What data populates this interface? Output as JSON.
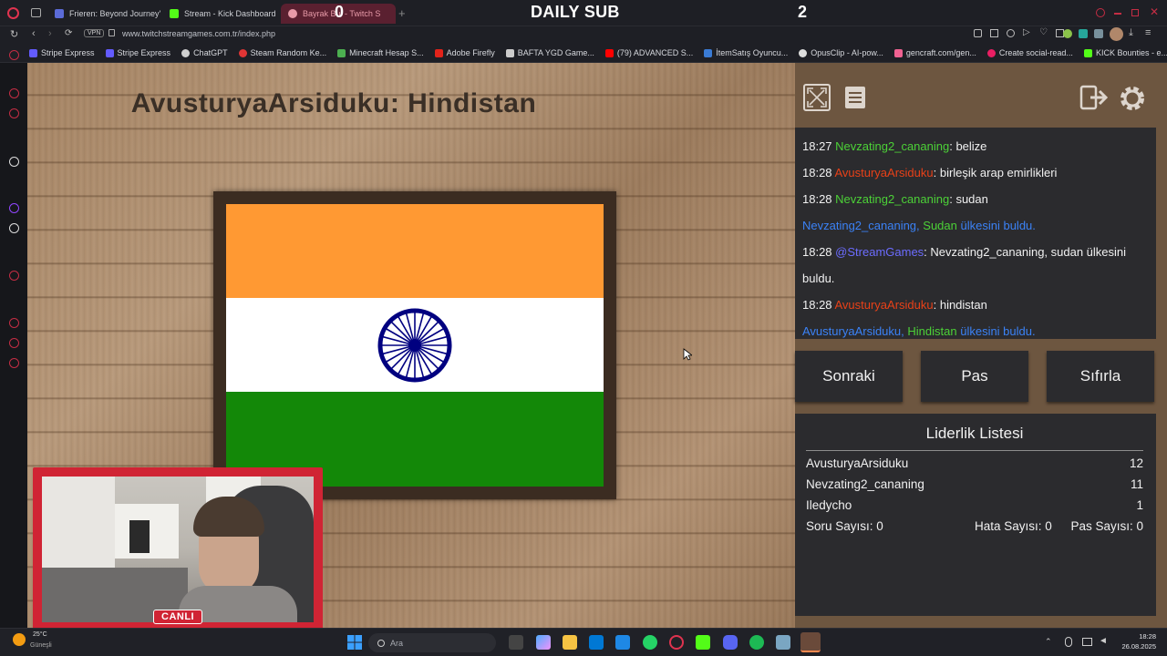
{
  "browser": {
    "tabs": [
      {
        "label": "Frieren: Beyond Journey's",
        "color": "#5b6bd8"
      },
      {
        "label": "Stream - Kick Dashboard",
        "color": "#53fc18"
      },
      {
        "label": "Bayrak Bul - Twitch S",
        "color": "#e79aa8"
      }
    ],
    "overlay_left_count": "0",
    "overlay_title": "DAILY SUB",
    "overlay_right_count": "2",
    "vpn_label": "VPN",
    "url": "www.twitchstreamgames.com.tr/index.php",
    "bookmarks": [
      {
        "label": "Stripe Express",
        "color": "#635bff"
      },
      {
        "label": "Stripe Express",
        "color": "#635bff"
      },
      {
        "label": "ChatGPT",
        "color": "#d0d0d0"
      },
      {
        "label": "Steam Random Ke...",
        "color": "#e03535"
      },
      {
        "label": "Minecraft Hesap S...",
        "color": "#4caf50"
      },
      {
        "label": "Adobe Firefly",
        "color": "#e2231a"
      },
      {
        "label": "BAFTA YGD Game...",
        "color": "#cccccc"
      },
      {
        "label": "(79) ADVANCED S...",
        "color": "#ff0000"
      },
      {
        "label": "İtemSatış Oyuncu...",
        "color": "#3a7bd5"
      },
      {
        "label": "OpusClip - AI-pow...",
        "color": "#dddddd"
      },
      {
        "label": "gencraft.com/gen...",
        "color": "#f06292"
      },
      {
        "label": "Create social-read...",
        "color": "#e91e63"
      },
      {
        "label": "KICK Bounties - e...",
        "color": "#53fc18"
      }
    ]
  },
  "game": {
    "question": "AvusturyaArsiduku: Hindistan",
    "flag": {
      "top": "#ff9933",
      "middle": "#ffffff",
      "bottom": "#138808",
      "chakra": "#000080"
    }
  },
  "webcam": {
    "live_label": "CANLI"
  },
  "chat": {
    "messages": [
      {
        "time": "18:27",
        "user": "Nevzating2_cananing",
        "user_color": "#4cd137",
        "text": ": belize"
      },
      {
        "time": "18:28",
        "user": "AvusturyaArsiduku",
        "user_color": "#e84118",
        "text": ": birleşik arap emirlikleri"
      },
      {
        "time": "18:28",
        "user": "Nevzating2_cananing",
        "user_color": "#4cd137",
        "text": ": sudan"
      },
      {
        "system": true,
        "user": "Nevzating2_cananing,",
        "country": "Sudan",
        "suffix": "ülkesini buldu."
      },
      {
        "time": "18:28",
        "user": "@StreamGames",
        "user_color": "#6c6cff",
        "text": ": Nevzating2_cananing, sudan ülkesini buldu.",
        "wrap": true
      },
      {
        "time": "18:28",
        "user": "AvusturyaArsiduku",
        "user_color": "#e84118",
        "text": ": hindistan"
      },
      {
        "system": true,
        "user": "AvusturyaArsiduku,",
        "country": "Hindistan",
        "suffix": "ülkesini buldu."
      }
    ]
  },
  "actions": {
    "next": "Sonraki",
    "pass": "Pas",
    "reset": "Sıfırla"
  },
  "leaderboard": {
    "title": "Liderlik Listesi",
    "rows": [
      {
        "name": "AvusturyaArsiduku",
        "score": "12"
      },
      {
        "name": "Nevzating2_cananing",
        "score": "11"
      },
      {
        "name": "Iledycho",
        "score": "1"
      }
    ],
    "question_count": "Soru Sayısı: 0",
    "error_count": "Hata Sayısı: 0",
    "pass_count": "Pas Sayısı: 0"
  },
  "taskbar": {
    "weather_temp": "25°C",
    "weather_label": "Güneşli",
    "search_placeholder": "Ara",
    "time": "18:28",
    "date": "26.08.2025"
  }
}
